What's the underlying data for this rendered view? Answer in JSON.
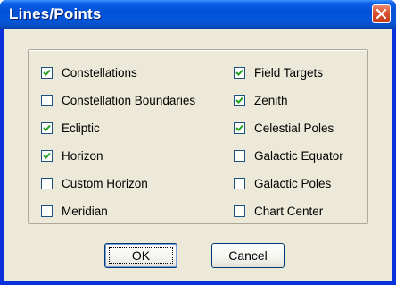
{
  "window": {
    "title": "Lines/Points"
  },
  "checkboxes_left": [
    {
      "label": "Constellations",
      "checked": true
    },
    {
      "label": "Constellation Boundaries",
      "checked": false
    },
    {
      "label": "Ecliptic",
      "checked": true
    },
    {
      "label": "Horizon",
      "checked": true
    },
    {
      "label": "Custom Horizon",
      "checked": false
    },
    {
      "label": "Meridian",
      "checked": false
    }
  ],
  "checkboxes_right": [
    {
      "label": "Field Targets",
      "checked": true
    },
    {
      "label": "Zenith",
      "checked": true
    },
    {
      "label": "Celestial Poles",
      "checked": true
    },
    {
      "label": "Galactic Equator",
      "checked": false
    },
    {
      "label": "Galactic Poles",
      "checked": false
    },
    {
      "label": "Chart Center",
      "checked": false
    }
  ],
  "buttons": {
    "ok": "OK",
    "cancel": "Cancel"
  },
  "colors": {
    "titlebar": "#0450d8",
    "face": "#ece9d8",
    "close": "#d8502f"
  }
}
